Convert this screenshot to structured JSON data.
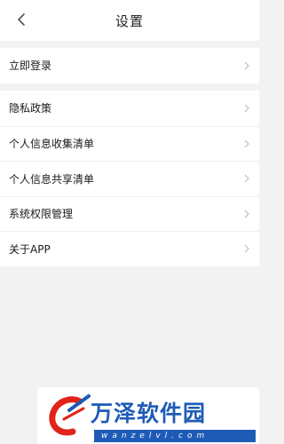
{
  "header": {
    "title": "设置",
    "back_icon": "chevron-left-icon"
  },
  "login_group": {
    "items": [
      {
        "label": "立即登录",
        "icon": "chevron-right-icon"
      }
    ]
  },
  "settings_group": {
    "items": [
      {
        "label": "隐私政策",
        "icon": "chevron-right-icon"
      },
      {
        "label": "个人信息收集清单",
        "icon": "chevron-right-icon"
      },
      {
        "label": "个人信息共享清单",
        "icon": "chevron-right-icon"
      },
      {
        "label": "系统权限管理",
        "icon": "chevron-right-icon"
      },
      {
        "label": "关于APP",
        "icon": "chevron-right-icon"
      }
    ]
  },
  "watermark": {
    "brand_cn": "万泽软件园",
    "brand_en": "wanzelvl.com"
  },
  "colors": {
    "background": "#f2f2f2",
    "surface": "#ffffff",
    "text": "#1a1a1a",
    "chevron": "#bbbbbb",
    "watermark_blue": "#1e5bb7",
    "watermark_red": "#e2231a"
  }
}
